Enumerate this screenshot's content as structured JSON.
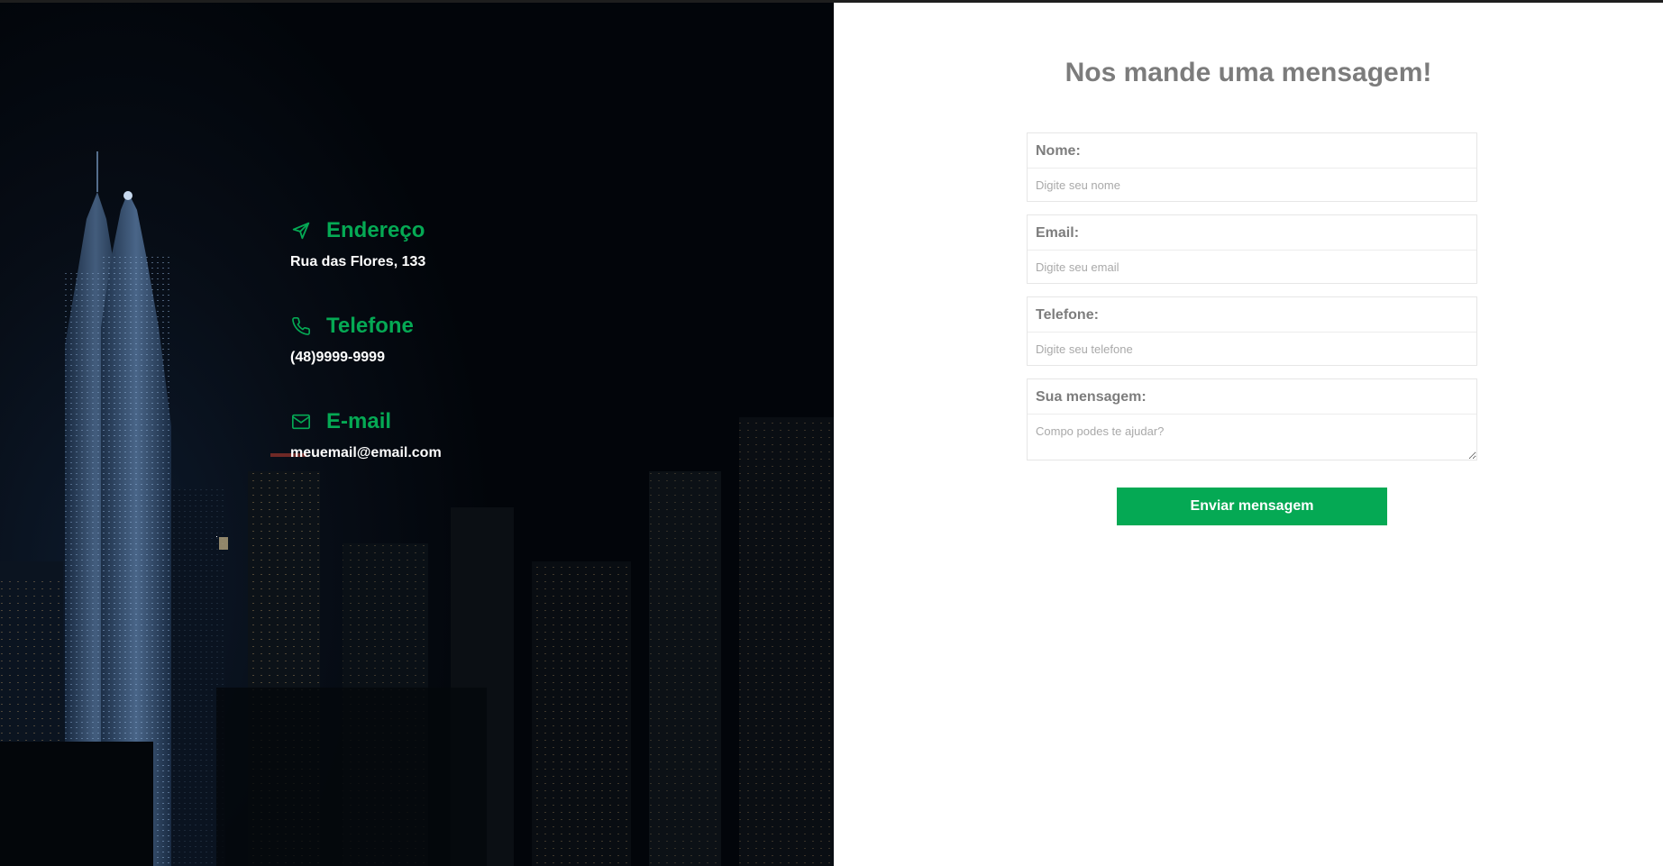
{
  "contact": {
    "address": {
      "icon": "navigation-arrow-icon",
      "title": "Endereço",
      "value": "Rua das Flores, 133"
    },
    "phone": {
      "icon": "phone-icon",
      "title": "Telefone",
      "value": "(48)9999-9999"
    },
    "email": {
      "icon": "mail-envelope-icon",
      "title": "E-mail",
      "value": "meuemail@email.com"
    }
  },
  "form": {
    "title": "Nos mande uma mensagem!",
    "name": {
      "label": "Nome:",
      "placeholder": "Digite seu nome",
      "value": ""
    },
    "email": {
      "label": "Email:",
      "placeholder": "Digite seu email",
      "value": ""
    },
    "phone": {
      "label": "Telefone:",
      "placeholder": "Digite seu telefone",
      "value": ""
    },
    "message": {
      "label": "Sua mensagem:",
      "placeholder": "Compo podes te ajudar?",
      "value": ""
    },
    "submit_label": "Enviar mensagem"
  },
  "colors": {
    "accent": "#05a954",
    "left_background": "#03070c",
    "heading_gray": "#7c7c7c",
    "label_gray": "#7d7d7d"
  }
}
